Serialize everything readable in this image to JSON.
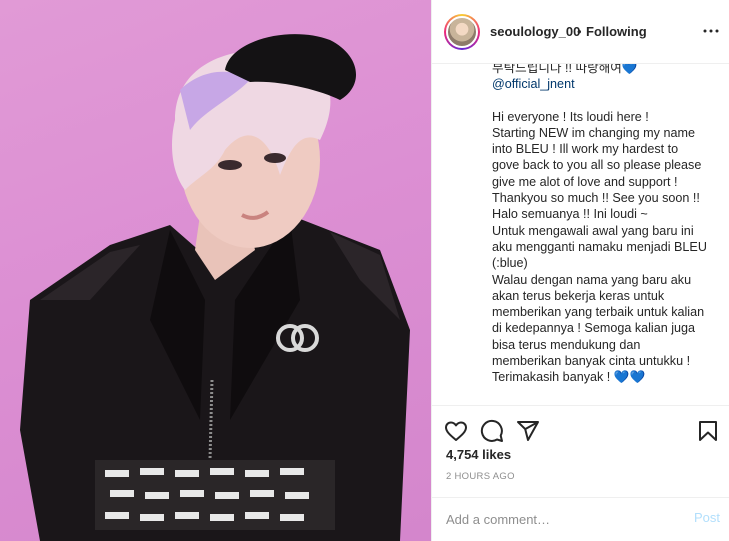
{
  "post": {
    "author": "seoulology_00",
    "separator": "•",
    "follow_status": "Following"
  },
  "caption": {
    "line_korean": "부탁드립니다 !! 따랑해여",
    "mention": "@official_jnent",
    "lines": [
      "Hi everyone ! Its loudi here !",
      "Starting NEW im changing my name",
      "into BLEU ! Ill work my hardest to",
      "gove back to you all so please please",
      "give me alot of love and support !",
      "Thankyou so much !! See you soon !!",
      "Halo semuanya !! Ini loudi ~",
      "Untuk mengawali awal yang baru ini",
      "aku mengganti namaku menjadi BLEU",
      "(:blue)",
      "Walau dengan nama yang baru aku",
      "akan terus bekerja keras untuk",
      "memberikan yang terbaik untuk kalian",
      "di kedepannya ! Semoga kalian juga",
      "bisa terus mendukung dan",
      "memberikan banyak cinta untukku !",
      "Terimakasih banyak !"
    ],
    "heart": "💙"
  },
  "stats": {
    "likes": "4,754 likes",
    "timestamp": "2 HOURS AGO"
  },
  "comment": {
    "placeholder": "Add a comment…",
    "post_label": "Post"
  },
  "icons": {
    "more": "more-options-icon",
    "like": "heart-icon",
    "comment": "comment-icon",
    "share": "share-icon",
    "save": "bookmark-icon"
  },
  "colors": {
    "photo_background": "#dc8fd3",
    "mention": "#00376b",
    "post_button_disabled": "#b2dffc",
    "heart": "#1e7fd6"
  }
}
